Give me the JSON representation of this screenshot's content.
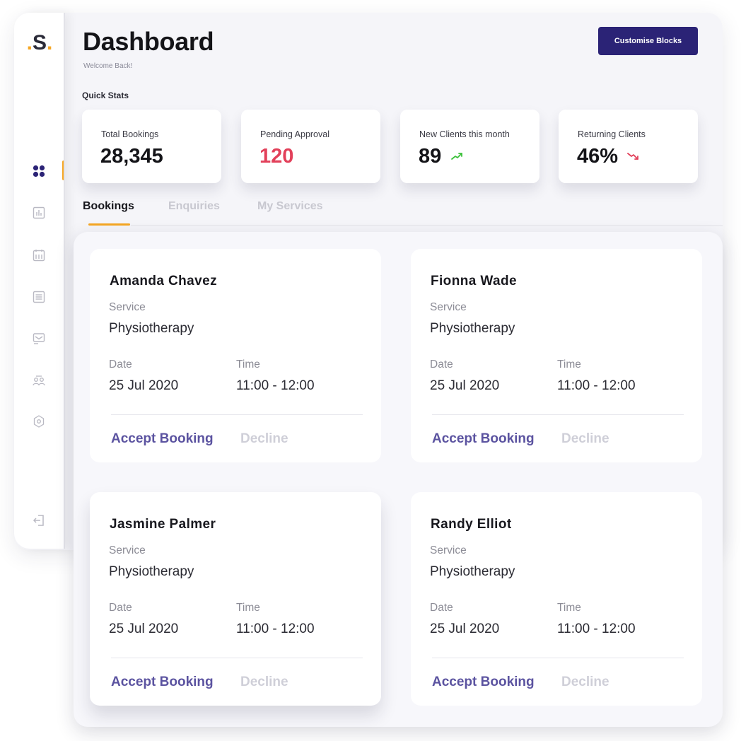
{
  "sidebar": {
    "logo": {
      "dot_left": ".",
      "letter": "S",
      "dot_right": "."
    },
    "items": [
      {
        "name": "dashboard",
        "icon": "grid-icon",
        "active": true
      },
      {
        "name": "analytics",
        "icon": "bar-chart-icon",
        "active": false
      },
      {
        "name": "calendar",
        "icon": "calendar-icon",
        "active": false
      },
      {
        "name": "list",
        "icon": "list-icon",
        "active": false
      },
      {
        "name": "messages",
        "icon": "message-icon",
        "active": false
      },
      {
        "name": "clients",
        "icon": "users-icon",
        "active": false
      },
      {
        "name": "settings",
        "icon": "gear-icon",
        "active": false
      },
      {
        "name": "logout",
        "icon": "logout-icon",
        "active": false
      }
    ]
  },
  "header": {
    "title": "Dashboard",
    "subtitle": "Welcome Back!",
    "customise_button": "Customise Blocks"
  },
  "quick_stats": {
    "label": "Quick Stats",
    "cards": [
      {
        "label": "Total Bookings",
        "value": "28,345",
        "trend": null
      },
      {
        "label": "Pending Approval",
        "value": "120",
        "trend": null,
        "value_color": "#e2405a"
      },
      {
        "label": "New Clients this month",
        "value": "89",
        "trend": "up"
      },
      {
        "label": "Returning Clients",
        "value": "46%",
        "trend": "down"
      }
    ]
  },
  "tabs": [
    {
      "label": "Bookings",
      "active": true
    },
    {
      "label": "Enquiries",
      "active": false
    },
    {
      "label": "My Services",
      "active": false
    }
  ],
  "bookings": [
    {
      "name": "Amanda Chavez",
      "service_label": "Service",
      "service": "Physiotherapy",
      "date_label": "Date",
      "date": "25 Jul 2020",
      "time_label": "Time",
      "time": "11:00 - 12:00",
      "accept": "Accept Booking",
      "decline": "Decline"
    },
    {
      "name": "Fionna Wade",
      "service_label": "Service",
      "service": "Physiotherapy",
      "date_label": "Date",
      "date": "25 Jul 2020",
      "time_label": "Time",
      "time": "11:00 - 12:00",
      "accept": "Accept Booking",
      "decline": "Decline"
    },
    {
      "name": "Jasmine Palmer",
      "service_label": "Service",
      "service": "Physiotherapy",
      "date_label": "Date",
      "date": "25 Jul 2020",
      "time_label": "Time",
      "time": "11:00 - 12:00",
      "accept": "Accept Booking",
      "decline": "Decline"
    },
    {
      "name": "Randy Elliot",
      "service_label": "Service",
      "service": "Physiotherapy",
      "date_label": "Date",
      "date": "25 Jul 2020",
      "time_label": "Time",
      "time": "11:00 - 12:00",
      "accept": "Accept Booking",
      "decline": "Decline"
    }
  ],
  "colors": {
    "primary": "#2b2376",
    "accent": "#f5a623",
    "danger": "#e2405a",
    "success": "#3cc13b",
    "link": "#5b53a0"
  }
}
